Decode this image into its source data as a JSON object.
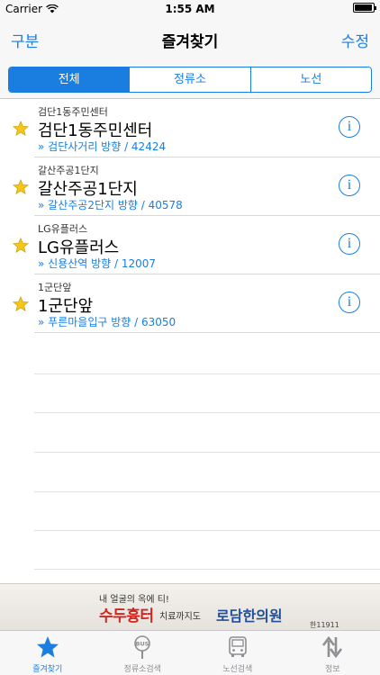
{
  "status_bar": {
    "carrier": "Carrier",
    "time": "1:55 AM"
  },
  "nav": {
    "left_label": "구분",
    "title": "즐겨찾기",
    "right_label": "수정"
  },
  "segments": [
    {
      "label": "전체",
      "selected": true
    },
    {
      "label": "정류소",
      "selected": false
    },
    {
      "label": "노선",
      "selected": false
    }
  ],
  "favorites": [
    {
      "small_name": "검단1동주민센터",
      "name": "검단1동주민센터",
      "direction": "» 검단사거리 방향 / 42424"
    },
    {
      "small_name": "갈산주공1단지",
      "name": "갈산주공1단지",
      "direction": "» 갈산주공2단지 방향 / 40578"
    },
    {
      "small_name": "LG유플러스",
      "name": "LG유플러스",
      "direction": "» 신용산역 방향 / 12007"
    },
    {
      "small_name": "1군단앞",
      "name": "1군단앞",
      "direction": "» 푸른마을입구 방향 / 63050"
    }
  ],
  "ad": {
    "line1": "내 얼굴의 옥에 티!",
    "main": "수두흉터",
    "mid": "치료까지도",
    "brand": "로담한의원",
    "code": "한11911"
  },
  "tabs": [
    {
      "label": "즐겨찾기",
      "icon": "star-icon",
      "active": true
    },
    {
      "label": "정류소검색",
      "icon": "bus-stop-icon",
      "active": false
    },
    {
      "label": "노선검색",
      "icon": "bus-icon",
      "active": false
    },
    {
      "label": "정보",
      "icon": "up-down-arrows-icon",
      "active": false
    }
  ],
  "colors": {
    "accent": "#1a7ee0",
    "star": "#f5c518",
    "ad_red": "#d1261f",
    "ad_blue": "#1f4f9a"
  }
}
